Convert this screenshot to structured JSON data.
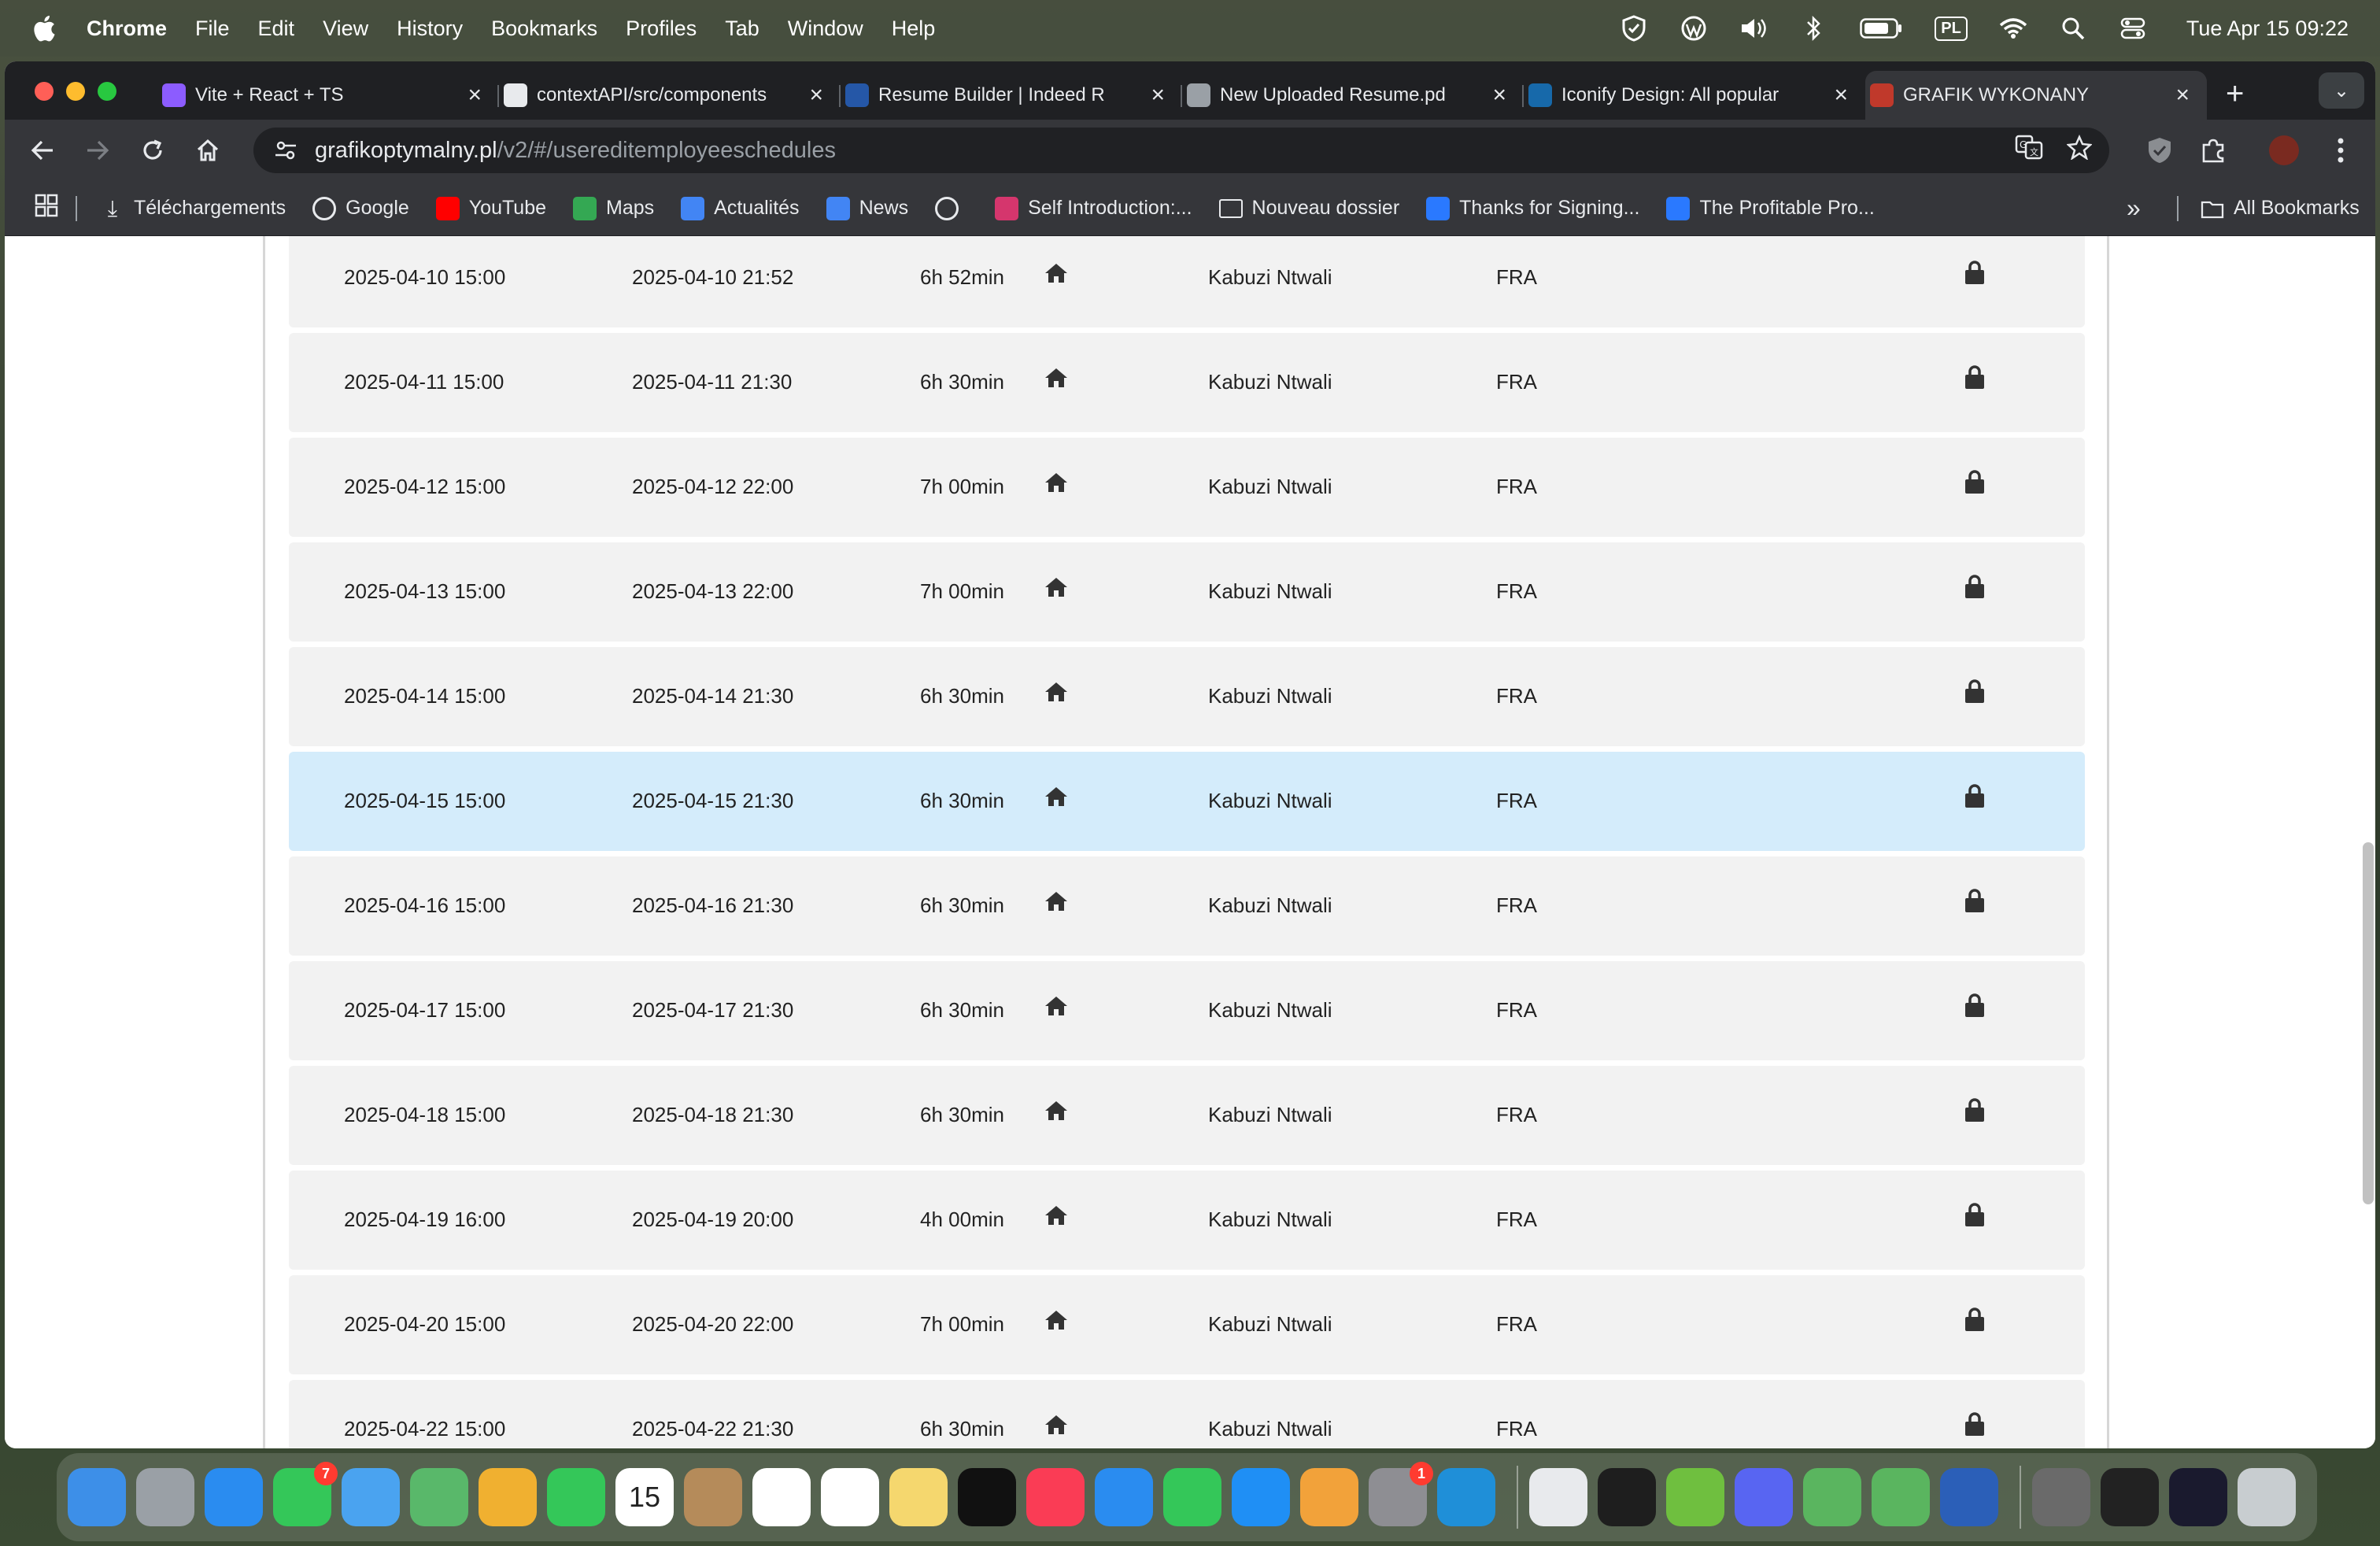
{
  "menubar": {
    "app_name": "Chrome",
    "items": [
      "File",
      "Edit",
      "View",
      "History",
      "Bookmarks",
      "Profiles",
      "Tab",
      "Window",
      "Help"
    ],
    "input_source": "PL",
    "clock": "Tue Apr 15  09:22"
  },
  "tabs": [
    {
      "title": "Vite + React + TS",
      "icon": "vite-icon",
      "color": "#8c5cff"
    },
    {
      "title": "contextAPI/src/components",
      "icon": "github-icon",
      "color": "#e8eaed"
    },
    {
      "title": "Resume Builder | Indeed R",
      "icon": "indeed-icon",
      "color": "#2557a7"
    },
    {
      "title": "New Uploaded Resume.pd",
      "icon": "globe-icon",
      "color": "#9aa0a6"
    },
    {
      "title": "Iconify Design: All popular",
      "icon": "iconify-icon",
      "color": "#1769aa"
    },
    {
      "title": "GRAFIK WYKONANY",
      "icon": "grafik-icon",
      "color": "#c0392b",
      "active": true
    }
  ],
  "address": {
    "host": "grafikoptymalny.pl",
    "path": "/v2/#/usereditemployeeschedules"
  },
  "bookmarks": [
    {
      "label": "Téléchargements",
      "icon": "download-icon"
    },
    {
      "label": "Google",
      "icon": "globe-icon"
    },
    {
      "label": "YouTube",
      "icon": "youtube-icon"
    },
    {
      "label": "Maps",
      "icon": "maps-icon"
    },
    {
      "label": "Actualités",
      "icon": "news-icon"
    },
    {
      "label": "News",
      "icon": "news-icon"
    },
    {
      "label": "",
      "icon": "globe-icon"
    },
    {
      "label": "Self Introduction:...",
      "icon": "link-icon"
    },
    {
      "label": "Nouveau dossier",
      "icon": "folder-icon"
    },
    {
      "label": "Thanks for Signing...",
      "icon": "bookmark-icon"
    },
    {
      "label": "The Profitable Pro...",
      "icon": "bookmark-icon"
    }
  ],
  "bookmarks_all": "All Bookmarks",
  "schedule": {
    "rows": [
      {
        "start": "2025-04-10 15:00",
        "end": "2025-04-10 21:52",
        "duration": "6h 52min",
        "employee": "Kabuzi Ntwali",
        "code": "FRA"
      },
      {
        "start": "2025-04-11 15:00",
        "end": "2025-04-11 21:30",
        "duration": "6h 30min",
        "employee": "Kabuzi Ntwali",
        "code": "FRA"
      },
      {
        "start": "2025-04-12 15:00",
        "end": "2025-04-12 22:00",
        "duration": "7h 00min",
        "employee": "Kabuzi Ntwali",
        "code": "FRA"
      },
      {
        "start": "2025-04-13 15:00",
        "end": "2025-04-13 22:00",
        "duration": "7h 00min",
        "employee": "Kabuzi Ntwali",
        "code": "FRA"
      },
      {
        "start": "2025-04-14 15:00",
        "end": "2025-04-14 21:30",
        "duration": "6h 30min",
        "employee": "Kabuzi Ntwali",
        "code": "FRA"
      },
      {
        "start": "2025-04-15 15:00",
        "end": "2025-04-15 21:30",
        "duration": "6h 30min",
        "employee": "Kabuzi Ntwali",
        "code": "FRA",
        "highlight": true
      },
      {
        "start": "2025-04-16 15:00",
        "end": "2025-04-16 21:30",
        "duration": "6h 30min",
        "employee": "Kabuzi Ntwali",
        "code": "FRA"
      },
      {
        "start": "2025-04-17 15:00",
        "end": "2025-04-17 21:30",
        "duration": "6h 30min",
        "employee": "Kabuzi Ntwali",
        "code": "FRA"
      },
      {
        "start": "2025-04-18 15:00",
        "end": "2025-04-18 21:30",
        "duration": "6h 30min",
        "employee": "Kabuzi Ntwali",
        "code": "FRA"
      },
      {
        "start": "2025-04-19 16:00",
        "end": "2025-04-19 20:00",
        "duration": "4h 00min",
        "employee": "Kabuzi Ntwali",
        "code": "FRA"
      },
      {
        "start": "2025-04-20 15:00",
        "end": "2025-04-20 22:00",
        "duration": "7h 00min",
        "employee": "Kabuzi Ntwali",
        "code": "FRA"
      },
      {
        "start": "2025-04-22 15:00",
        "end": "2025-04-22 21:30",
        "duration": "6h 30min",
        "employee": "Kabuzi Ntwali",
        "code": "FRA"
      }
    ],
    "highlight_color": "#d4ecfb",
    "row_color": "#f2f2f2"
  },
  "dock": {
    "apps": [
      {
        "name": "finder-icon",
        "color": "#3d8fe8"
      },
      {
        "name": "launchpad-icon",
        "color": "#9aa0a6"
      },
      {
        "name": "safari-icon",
        "color": "#2a8cf0"
      },
      {
        "name": "messages-icon",
        "color": "#34c759",
        "badge": "7"
      },
      {
        "name": "mail-icon",
        "color": "#4aa3f0"
      },
      {
        "name": "maps-icon",
        "color": "#59b86a"
      },
      {
        "name": "photos-icon",
        "color": "#f0b030"
      },
      {
        "name": "facetime-icon",
        "color": "#34c759"
      },
      {
        "name": "calendar-icon",
        "color": "#ffffff",
        "label": "15"
      },
      {
        "name": "contacts-icon",
        "color": "#b58b5a"
      },
      {
        "name": "reminders-icon",
        "color": "#ffffff"
      },
      {
        "name": "freeform-icon",
        "color": "#ffffff"
      },
      {
        "name": "notes-icon",
        "color": "#f5d76e"
      },
      {
        "name": "tv-icon",
        "color": "#111111"
      },
      {
        "name": "music-icon",
        "color": "#fa3c55"
      },
      {
        "name": "keynote-icon",
        "color": "#2a8cf0"
      },
      {
        "name": "numbers-icon",
        "color": "#34c759"
      },
      {
        "name": "appstore-icon",
        "color": "#1f8ff5"
      },
      {
        "name": "pages-icon",
        "color": "#f2a23a"
      },
      {
        "name": "settings-icon",
        "color": "#8e8e93",
        "badge": "1"
      },
      {
        "name": "vscode-icon",
        "color": "#1f8fd8"
      },
      {
        "name": "chrome-icon",
        "color": "#e8eaed"
      },
      {
        "name": "terminal-icon",
        "color": "#1e1e1e"
      },
      {
        "name": "utorrent-icon",
        "color": "#6fbf3f"
      },
      {
        "name": "discord-icon",
        "color": "#5865f2"
      },
      {
        "name": "shield-app-icon",
        "color": "#5ab55f"
      },
      {
        "name": "shield-app-2-icon",
        "color": "#5ab55f"
      },
      {
        "name": "word-icon",
        "color": "#2b5fb8"
      },
      {
        "name": "document-thumb-icon",
        "color": "#6a6a6a"
      },
      {
        "name": "window-thumb-icon",
        "color": "#222222"
      },
      {
        "name": "window-thumb-2-icon",
        "color": "#1a1a2e"
      },
      {
        "name": "trash-icon",
        "color": "#c8cdd0"
      }
    ]
  }
}
